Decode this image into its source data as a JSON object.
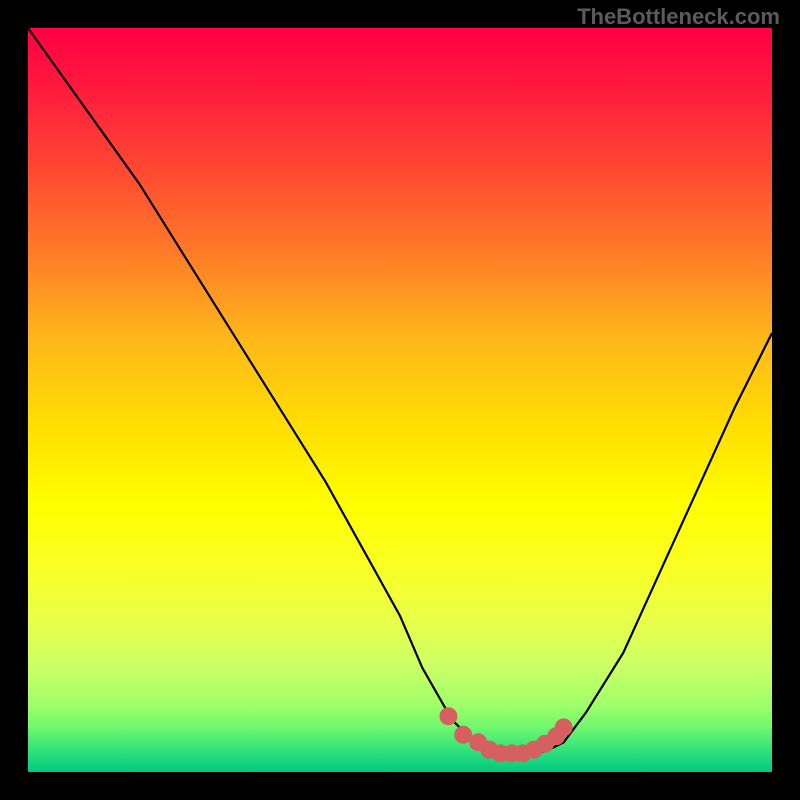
{
  "watermark": "TheBottleneck.com",
  "colors": {
    "background": "#000000",
    "curve": "#000000",
    "dots": "#d66060"
  },
  "chart_data": {
    "type": "line",
    "title": "",
    "xlabel": "",
    "ylabel": "",
    "xlim": [
      0,
      100
    ],
    "ylim": [
      0,
      100
    ],
    "grid": false,
    "series": [
      {
        "name": "bottleneck-curve",
        "x": [
          0,
          5,
          10,
          15,
          20,
          25,
          30,
          35,
          40,
          45,
          50,
          53,
          57,
          60,
          63,
          67,
          70,
          72,
          75,
          80,
          85,
          90,
          95,
          100
        ],
        "y": [
          100,
          93,
          86,
          79,
          71,
          63,
          55,
          47,
          39,
          30,
          21,
          14,
          7,
          4,
          2,
          2,
          3,
          4,
          8,
          16,
          27,
          38,
          49,
          59
        ]
      }
    ],
    "highlight_points": {
      "name": "optimal-range-dots",
      "x": [
        56.5,
        58.5,
        60.5,
        62.0,
        63.5,
        65.0,
        66.5,
        68.0,
        69.5,
        71.0,
        72.0
      ],
      "y": [
        7.5,
        5.0,
        4.0,
        3.0,
        2.5,
        2.5,
        2.5,
        3.0,
        3.8,
        4.8,
        6.0
      ]
    }
  }
}
